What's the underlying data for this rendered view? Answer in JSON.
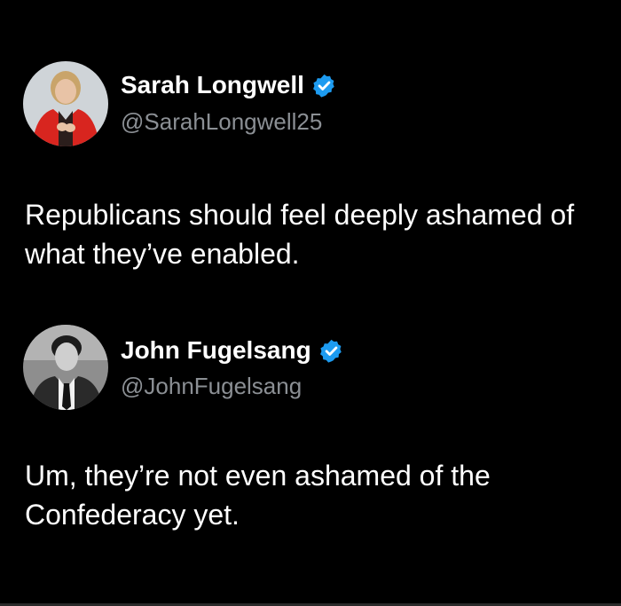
{
  "tweets": [
    {
      "author": {
        "name": "Sarah Longwell",
        "handle": "@SarahLongwell25",
        "verified": true,
        "avatar_description_icon": "profile-photo-woman-red-jacket"
      },
      "text": "Republicans should feel deeply ashamed of what they’ve enabled."
    },
    {
      "author": {
        "name": "John Fugelsang",
        "handle": "@JohnFugelsang",
        "verified": true,
        "avatar_description_icon": "profile-photo-man-dark-suit-bw"
      },
      "text": "Um, they’re not even ashamed of the Confederacy yet."
    }
  ],
  "colors": {
    "background": "#000000",
    "name": "#ffffff",
    "handle": "#8b8f94",
    "text": "#ffffff",
    "verified": "#1d9bf0"
  }
}
